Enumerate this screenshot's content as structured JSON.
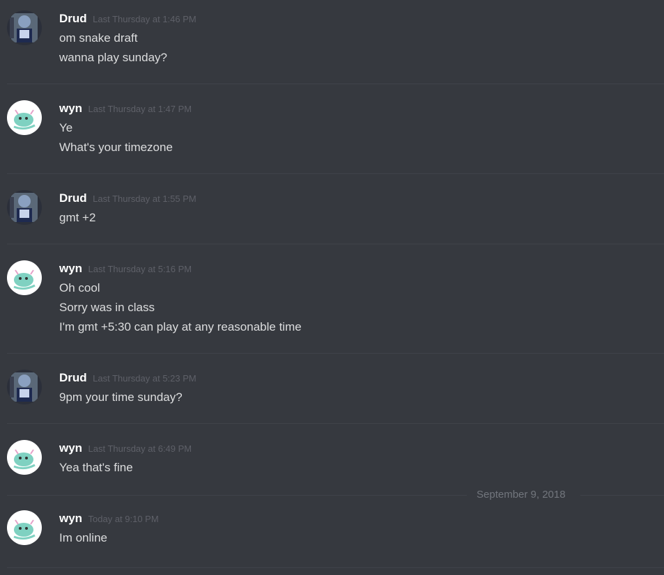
{
  "messages": [
    {
      "user": "Drud",
      "time": "Last Thursday at 1:46 PM",
      "lines": [
        "om snake draft",
        "wanna play sunday?"
      ],
      "avatar": "drud-avatar-icon"
    },
    {
      "user": "wyn",
      "time": "Last Thursday at 1:47 PM",
      "lines": [
        "Ye",
        "What's your timezone"
      ],
      "avatar": "wyn-avatar-icon"
    },
    {
      "user": "Drud",
      "time": "Last Thursday at 1:55 PM",
      "lines": [
        "gmt +2"
      ],
      "avatar": "drud-avatar-icon"
    },
    {
      "user": "wyn",
      "time": "Last Thursday at 5:16 PM",
      "lines": [
        "Oh cool",
        "Sorry was in class",
        "I'm gmt +5:30 can play at any reasonable time"
      ],
      "avatar": "wyn-avatar-icon"
    },
    {
      "user": "Drud",
      "time": "Last Thursday at 5:23 PM",
      "lines": [
        "9pm your time sunday?"
      ],
      "avatar": "drud-avatar-icon"
    },
    {
      "user": "wyn",
      "time": "Last Thursday at 6:49 PM",
      "lines": [
        "Yea that's fine"
      ],
      "avatar": "wyn-avatar-icon"
    },
    {
      "user": "wyn",
      "time": "Today at 9:10 PM",
      "lines": [
        "Im online"
      ],
      "avatar": "wyn-avatar-icon"
    }
  ],
  "date_separator": "September 9, 2018",
  "colors": {
    "background": "#36393f",
    "username": "#ffffff",
    "timestamp": "#5e6068",
    "message_text": "#dcddde",
    "divider": "#40434a"
  }
}
